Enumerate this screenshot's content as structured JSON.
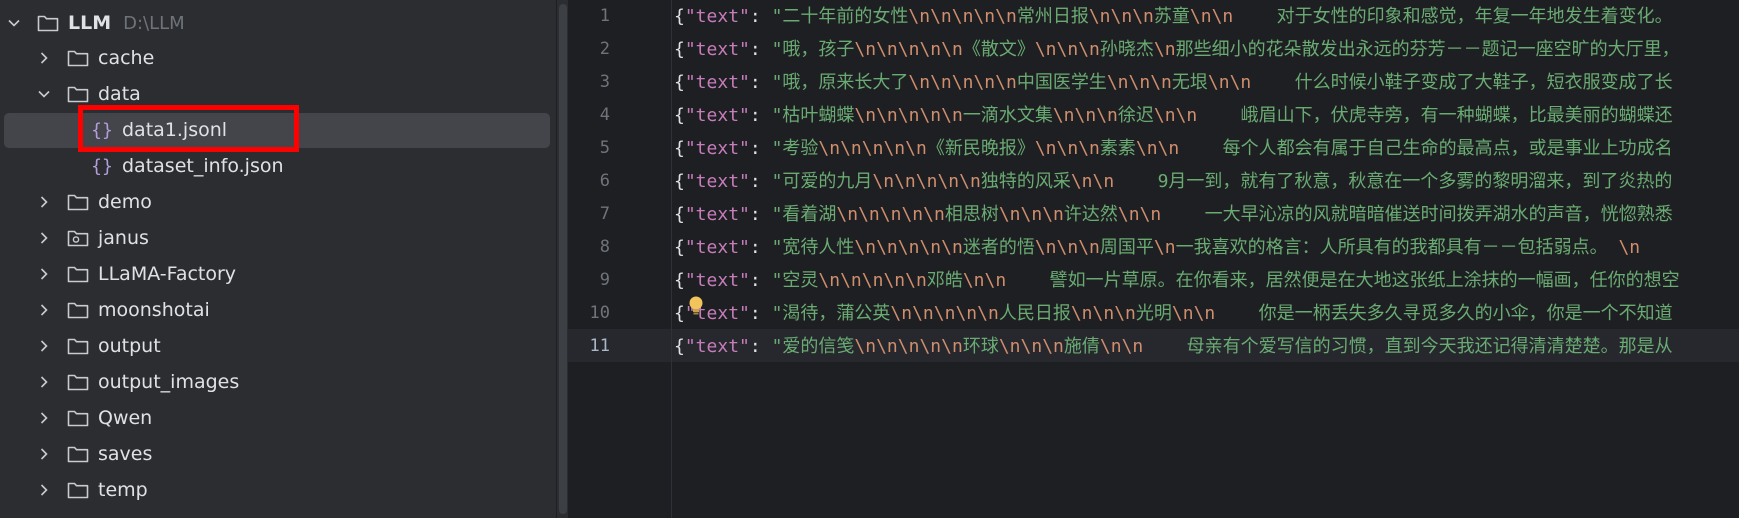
{
  "explorer": {
    "root": {
      "name": "LLM",
      "path": "D:\\LLM"
    },
    "items": [
      {
        "label": "cache",
        "type": "folder",
        "expanded": false
      },
      {
        "label": "data",
        "type": "folder",
        "expanded": true
      },
      {
        "label": "data1.jsonl",
        "type": "json-file",
        "selected": true,
        "highlighted": true
      },
      {
        "label": "dataset_info.json",
        "type": "json-file"
      },
      {
        "label": "demo",
        "type": "folder",
        "expanded": false
      },
      {
        "label": "janus",
        "type": "package-folder",
        "expanded": false
      },
      {
        "label": "LLaMA-Factory",
        "type": "folder",
        "expanded": false
      },
      {
        "label": "moonshotai",
        "type": "folder",
        "expanded": false
      },
      {
        "label": "output",
        "type": "folder",
        "expanded": false
      },
      {
        "label": "output_images",
        "type": "folder",
        "expanded": false
      },
      {
        "label": "Qwen",
        "type": "folder",
        "expanded": false
      },
      {
        "label": "saves",
        "type": "folder",
        "expanded": false
      },
      {
        "label": "temp",
        "type": "folder",
        "expanded": false
      }
    ],
    "highlight_color": "#ff0000"
  },
  "editor": {
    "active_line": 11,
    "lines": [
      {
        "no": "1",
        "key": "text",
        "value": "二十年前的女性\\n\\n\\n\\n\\n常州日报\\n\\n\\n苏童\\n\\n    对于女性的印象和感觉，年复一年地发生着变化。"
      },
      {
        "no": "2",
        "key": "text",
        "value": "哦，孩子\\n\\n\\n\\n\\n《散文》\\n\\n\\n孙晓杰\\n那些细小的花朵散发出永远的芬芳－－题记一座空旷的大厅里，"
      },
      {
        "no": "3",
        "key": "text",
        "value": "哦，原来长大了\\n\\n\\n\\n\\n中国医学生\\n\\n\\n无垠\\n\\n    什么时候小鞋子变成了大鞋子，短衣服变成了长"
      },
      {
        "no": "4",
        "key": "text",
        "value": "枯叶蝴蝶\\n\\n\\n\\n\\n一滴水文集\\n\\n\\n徐迟\\n\\n    峨眉山下，伏虎寺旁，有一种蝴蝶，比最美丽的蝴蝶还"
      },
      {
        "no": "5",
        "key": "text",
        "value": "考验\\n\\n\\n\\n\\n《新民晚报》\\n\\n\\n素素\\n\\n    每个人都会有属于自己生命的最高点，或是事业上功成名"
      },
      {
        "no": "6",
        "key": "text",
        "value": "可爱的九月\\n\\n\\n\\n\\n独特的风采\\n\\n    9月一到，就有了秋意，秋意在一个多雾的黎明溜来，到了炎热的"
      },
      {
        "no": "7",
        "key": "text",
        "value": "看着湖\\n\\n\\n\\n\\n相思树\\n\\n\\n许达然\\n\\n    一大早沁凉的风就暗暗催送时间拨弄湖水的声音，恍惚熟悉"
      },
      {
        "no": "8",
        "key": "text",
        "value": "宽待人性\\n\\n\\n\\n\\n迷者的悟\\n\\n\\n周国平\\n一我喜欢的格言：人所具有的我都具有－－包括弱点。 \\n"
      },
      {
        "no": "9",
        "key": "text",
        "value": "空灵\\n\\n\\n\\n\\n邓皓\\n\\n    譬如一片草原。在你看来，居然便是在大地这张纸上涂抹的一幅画，任你的想空"
      },
      {
        "no": "10",
        "key": "text",
        "value": "渴待，蒲公英\\n\\n\\n\\n\\n人民日报\\n\\n\\n光明\\n\\n    你是一柄丢失多久寻觅多久的小伞，你是一个不知道"
      },
      {
        "no": "11",
        "key": "text",
        "value": "爱的信笺\\n\\n\\n\\n\\n环球\\n\\n\\n施倩\\n\\n    母亲有个爱写信的习惯，直到今天我还记得清清楚楚。那是从"
      }
    ]
  }
}
